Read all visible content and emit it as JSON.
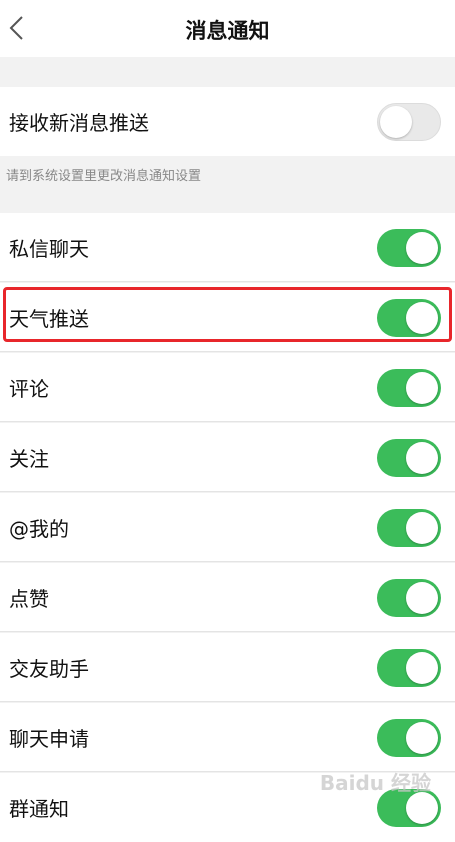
{
  "header": {
    "title": "消息通知",
    "back_icon": "chevron-left-icon"
  },
  "master": {
    "label": "接收新消息推送",
    "enabled": false
  },
  "hint": "请到系统设置里更改消息通知设置",
  "items": [
    {
      "label": "私信聊天",
      "enabled": true
    },
    {
      "label": "天气推送",
      "enabled": true,
      "highlighted": true
    },
    {
      "label": "评论",
      "enabled": true
    },
    {
      "label": "关注",
      "enabled": true
    },
    {
      "label": "@我的",
      "enabled": true
    },
    {
      "label": "点赞",
      "enabled": true
    },
    {
      "label": "交友助手",
      "enabled": true
    },
    {
      "label": "聊天申请",
      "enabled": true
    },
    {
      "label": "群通知",
      "enabled": true
    }
  ],
  "colors": {
    "toggle_on": "#3bbc5a",
    "toggle_off": "#e9e9e9",
    "highlight": "#e8262b"
  },
  "watermark": "Baidu 经验"
}
